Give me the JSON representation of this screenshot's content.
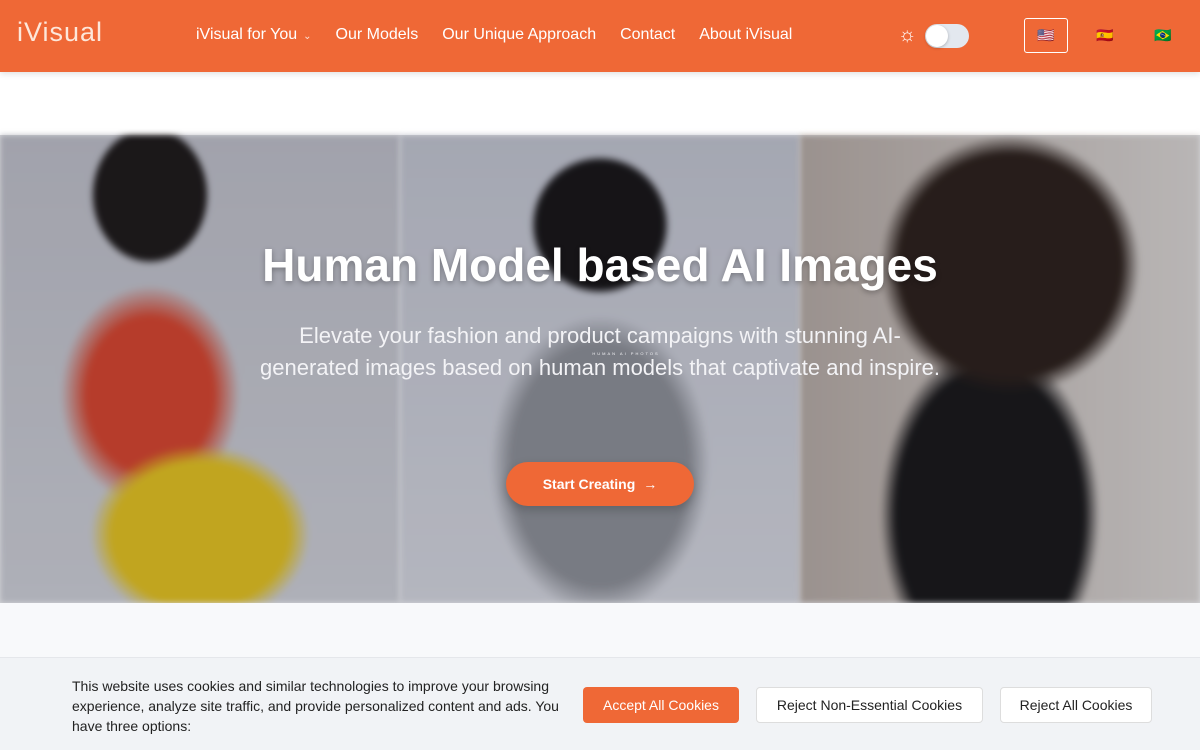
{
  "header": {
    "logo": "iVisual",
    "logo_tagline": "HUMAN AI PHOTOS",
    "nav": [
      "iVisual for You",
      "Our Models",
      "Our Unique Approach",
      "Contact",
      "About iVisual"
    ],
    "theme_icon": "sun-icon",
    "flags": [
      "🇺🇸",
      "🇪🇸",
      "🇧🇷"
    ]
  },
  "hero": {
    "title": "Human Model based AI Images",
    "subtitle": "Elevate your fashion and product campaigns with stunning AI-generated images based on human models that captivate and inspire.",
    "cta": "Start Creating",
    "cta_icon": "→"
  },
  "cookie": {
    "text": "This website uses cookies and similar technologies to improve your browsing experience, analyze site traffic, and provide personalized content and ads. You have three options:",
    "accept": "Accept All Cookies",
    "reject_non_essential": "Reject Non-Essential Cookies",
    "reject_all": "Reject All Cookies"
  },
  "colors": {
    "brand": "#ef6836"
  }
}
